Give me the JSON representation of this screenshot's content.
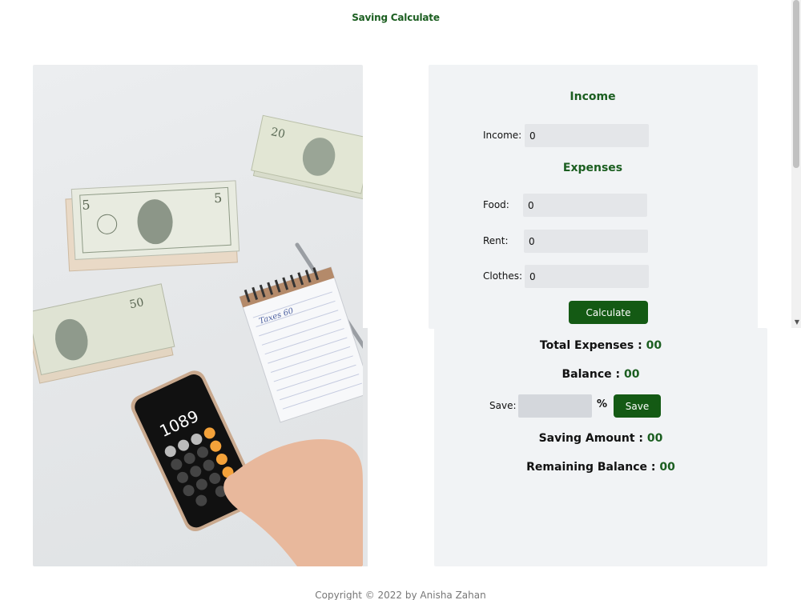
{
  "page": {
    "title": "Saving Calculate"
  },
  "income_card": {
    "income_heading": "Income",
    "income_label": "Income:",
    "income_value": "0",
    "expenses_heading": "Expenses",
    "food_label": "Food:",
    "food_value": "0",
    "rent_label": "Rent:",
    "rent_value": "0",
    "clothes_label": "Clothes:",
    "clothes_value": "0",
    "calculate_label": "Calculate"
  },
  "results": {
    "total_expenses_label": "Total Expenses :",
    "total_expenses_value": "00",
    "balance_label": "Balance :",
    "balance_value": "00",
    "save_label": "Save:",
    "save_value": "",
    "percent_symbol": "%",
    "save_button_label": "Save",
    "saving_amount_label": "Saving Amount :",
    "saving_amount_value": "00",
    "remaining_balance_label": "Remaining Balance :",
    "remaining_balance_value": "00"
  },
  "photo": {
    "calculator_display": "1089",
    "note_text": "Taxes 60"
  },
  "footer": {
    "copyright": "Copyright © 2022 by Anisha Zahan"
  },
  "colors": {
    "accent": "#1b5e20",
    "button": "#145a14",
    "card_bg": "#f1f3f5",
    "input_bg": "#e4e6e9"
  }
}
